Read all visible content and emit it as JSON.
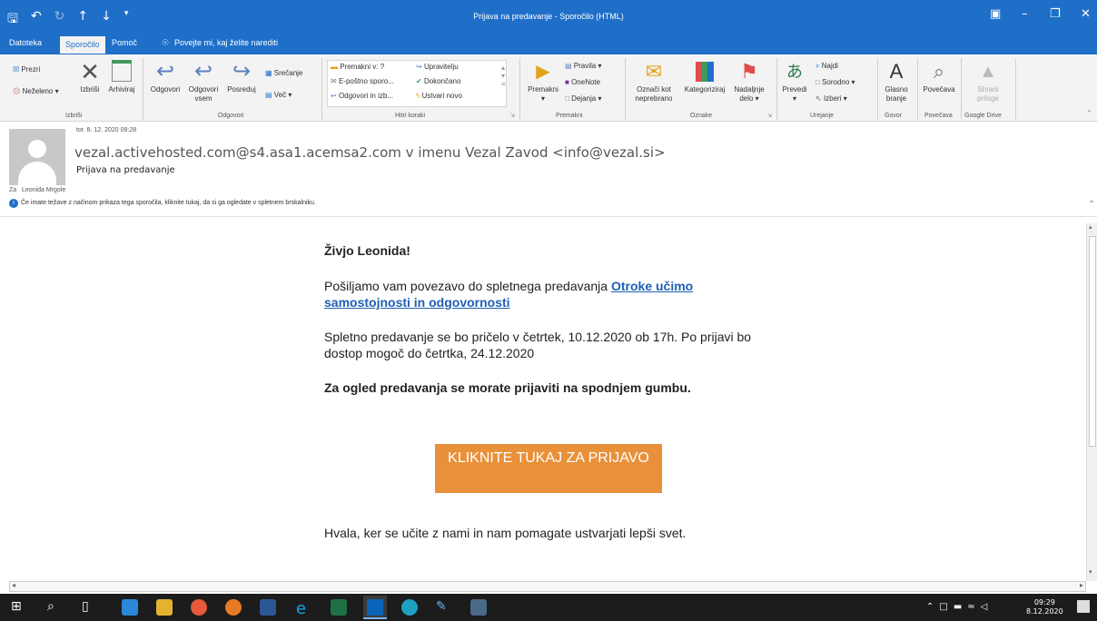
{
  "window": {
    "title": "Prijava na predavanje - Sporočilo (HTML)"
  },
  "tabs": [
    "Datoteka",
    "Sporočilo",
    "Pomoč"
  ],
  "tell_me": "Povejte mi, kaj želite narediti",
  "ribbon": {
    "groups": [
      "Izbriši",
      "Odgovori",
      "Hitri koraki",
      "Premakni",
      "Oznake",
      "Urejanje",
      "Govor",
      "Povečava",
      "Google Drive"
    ],
    "izbrisi": {
      "prezri": "Prezri",
      "nezeleno": "Neželeno",
      "izbrisi": "Izbriši",
      "arhiviraj": "Arhiviraj"
    },
    "odgovori": {
      "odgovori": "Odgovori",
      "odgovori_vsem_1": "Odgovori",
      "odgovori_vsem_2": "vsem",
      "posreduj": "Posreduj",
      "srecanje": "Srečanje",
      "vec": "Več"
    },
    "hitri": {
      "premakni_v": "Premakni v: ?",
      "eposta": "E-poštno sporo...",
      "odgovori_izb": "Odgovori in izb...",
      "upravitelju": "Upravitelju",
      "dokoncano": "Dokončano",
      "ustvari": "Ustvari novo"
    },
    "premakni": {
      "premakni": "Premakni",
      "pravila": "Pravila",
      "onenote": "OneNote",
      "dejanja": "Dejanja"
    },
    "oznake": {
      "oznaci_1": "Označi kot",
      "oznaci_2": "neprebrano",
      "kategoriziraj": "Kategoriziraj",
      "nadaljnje_1": "Nadaljnje",
      "nadaljnje_2": "delo"
    },
    "urejanje": {
      "prevedi": "Prevedi",
      "najdi": "Najdi",
      "sorodno": "Sorodno",
      "izberi": "Izberi"
    },
    "govor": {
      "glasno_1": "Glasno",
      "glasno_2": "branje"
    },
    "povecava": {
      "povecava": "Povečava"
    },
    "drive": {
      "shrani_1": "Shrani",
      "shrani_2": "priloge"
    }
  },
  "message": {
    "date": "tor. 8. 12. 2020 09:28",
    "sender": "vezal.activehosted.com@s4.asa1.acemsa2.com v imenu Vezal Zavod <info@vezal.si>",
    "subject": "Prijava na predavanje",
    "to_label": "Za",
    "to_name": "Leonida Mrgole",
    "info": "Če imate težave z načinom prikaza tega sporočila, kliknite tukaj, da si ga ogledate v spletnem brskalniku."
  },
  "body": {
    "greeting": "Živjo Leonida!",
    "p1_text": "Pošiljamo vam povezavo do spletnega predavanja ",
    "p1_link": "Otroke učimo samostojnosti in odgovornosti",
    "p2": "Spletno predavanje se bo pričelo v četrtek, 10.12.2020 ob 17h.  Po prijavi bo dostop mogoč do četrtka, 24.12.2020",
    "p3": "Za ogled predavanja se morate prijaviti na spodnjem gumbu.",
    "cta": "KLIKNITE TUKAJ ZA PRIJAVO",
    "closing": "Hvala, ker se učite z nami in nam pomagate ustvarjati lepši svet."
  },
  "taskbar": {
    "time": "09:29",
    "date": "8.12.2020"
  },
  "colors": {
    "titlebar": "#1f6fc9",
    "cta": "#e8913a",
    "link": "#1f5fb3"
  }
}
